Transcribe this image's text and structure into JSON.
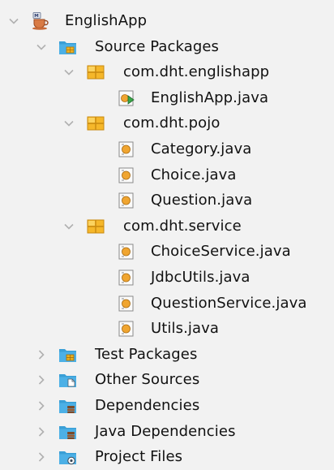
{
  "tree": {
    "project": {
      "label": "EnglishApp",
      "icon": "coffee-cup-project-icon",
      "expanded": true
    },
    "source_packages": {
      "label": "Source Packages",
      "icon": "source-packages-folder-icon",
      "expanded": true
    },
    "packages": [
      {
        "label": "com.dht.englishapp",
        "icon": "package-icon",
        "expanded": true,
        "files": [
          {
            "label": "EnglishApp.java",
            "icon": "java-main-class-icon"
          }
        ]
      },
      {
        "label": "com.dht.pojo",
        "icon": "package-icon",
        "expanded": true,
        "files": [
          {
            "label": "Category.java",
            "icon": "java-class-icon"
          },
          {
            "label": "Choice.java",
            "icon": "java-class-icon"
          },
          {
            "label": "Question.java",
            "icon": "java-class-icon"
          }
        ]
      },
      {
        "label": "com.dht.service",
        "icon": "package-icon",
        "expanded": true,
        "files": [
          {
            "label": "ChoiceService.java",
            "icon": "java-class-icon"
          },
          {
            "label": "JdbcUtils.java",
            "icon": "java-class-icon"
          },
          {
            "label": "QuestionService.java",
            "icon": "java-class-icon"
          },
          {
            "label": "Utils.java",
            "icon": "java-class-icon"
          }
        ]
      }
    ],
    "other_nodes": [
      {
        "label": "Test Packages",
        "icon": "test-packages-folder-icon",
        "expanded": false
      },
      {
        "label": "Other Sources",
        "icon": "other-sources-folder-icon",
        "expanded": false
      },
      {
        "label": "Dependencies",
        "icon": "dependencies-folder-icon",
        "expanded": false
      },
      {
        "label": "Java Dependencies",
        "icon": "java-dependencies-folder-icon",
        "expanded": false
      },
      {
        "label": "Project Files",
        "icon": "project-files-folder-icon",
        "expanded": false
      }
    ]
  },
  "colors": {
    "background": "#f2f2f2",
    "chevron": "#b0b0b0",
    "folder": "#3a9fd6",
    "package": "#e8a317",
    "text": "#111111"
  }
}
